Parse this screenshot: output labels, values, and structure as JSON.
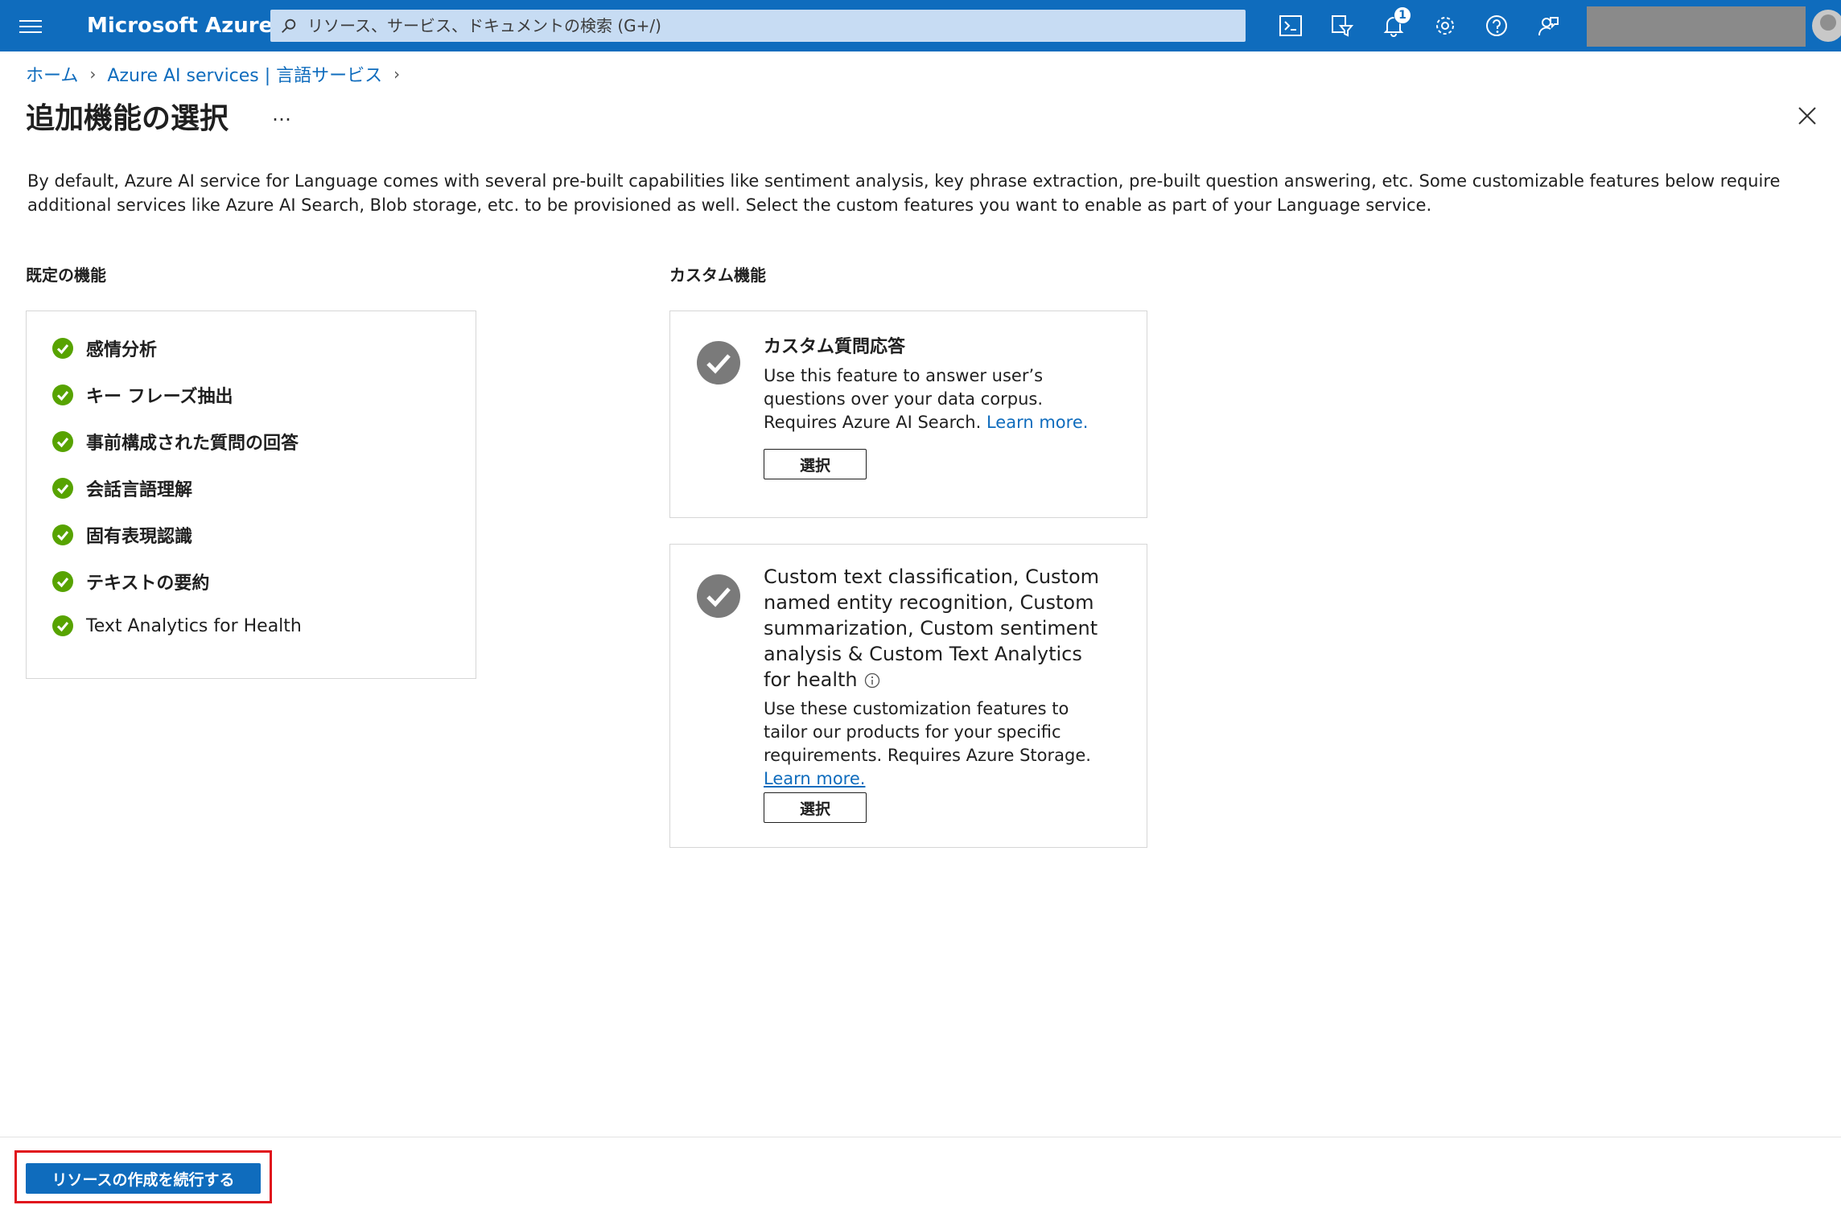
{
  "topbar": {
    "brand": "Microsoft Azure",
    "search_placeholder": "リソース、サービス、ドキュメントの検索 (G+/)",
    "notification_count": "1",
    "icons": [
      "cloud-shell-icon",
      "directory-filter-icon",
      "notifications-icon",
      "settings-icon",
      "help-icon",
      "feedback-icon"
    ]
  },
  "breadcrumb": {
    "home": "ホーム",
    "service": "Azure AI services | 言語サービス"
  },
  "page": {
    "title": "追加機能の選択",
    "more": "…",
    "description": "By default, Azure AI service for Language comes with several pre-built capabilities like sentiment analysis, key phrase extraction, pre-built question answering, etc. Some customizable features below require additional services like Azure AI Search, Blob storage, etc. to be provisioned as well. Select the custom features you want to enable as part of your Language service."
  },
  "default_features": {
    "label": "既定の機能",
    "items": [
      "感情分析",
      "キー フレーズ抽出",
      "事前構成された質問の回答",
      "会話言語理解",
      "固有表現認識",
      "テキストの要約",
      "Text Analytics for Health"
    ]
  },
  "custom_features": {
    "label": "カスタム機能",
    "cards": [
      {
        "title": "カスタム質問応答",
        "text": "Use this feature to answer user’s questions over your data corpus. Requires Azure AI Search.",
        "link": "Learn more.",
        "button": "選択"
      },
      {
        "title": "Custom text classification, Custom named entity recognition, Custom summarization, Custom sentiment analysis & Custom Text Analytics for health",
        "text": "Use these customization features to tailor our products for your specific requirements. Requires Azure Storage.",
        "link": "Learn more.",
        "button": "選択"
      }
    ]
  },
  "footer": {
    "continue_button": "リソースの作成を続行する"
  },
  "colors": {
    "accent": "#0f6cbd",
    "success": "#57a300",
    "highlight": "#e0121c",
    "selected_check": "#7a7a7a"
  }
}
